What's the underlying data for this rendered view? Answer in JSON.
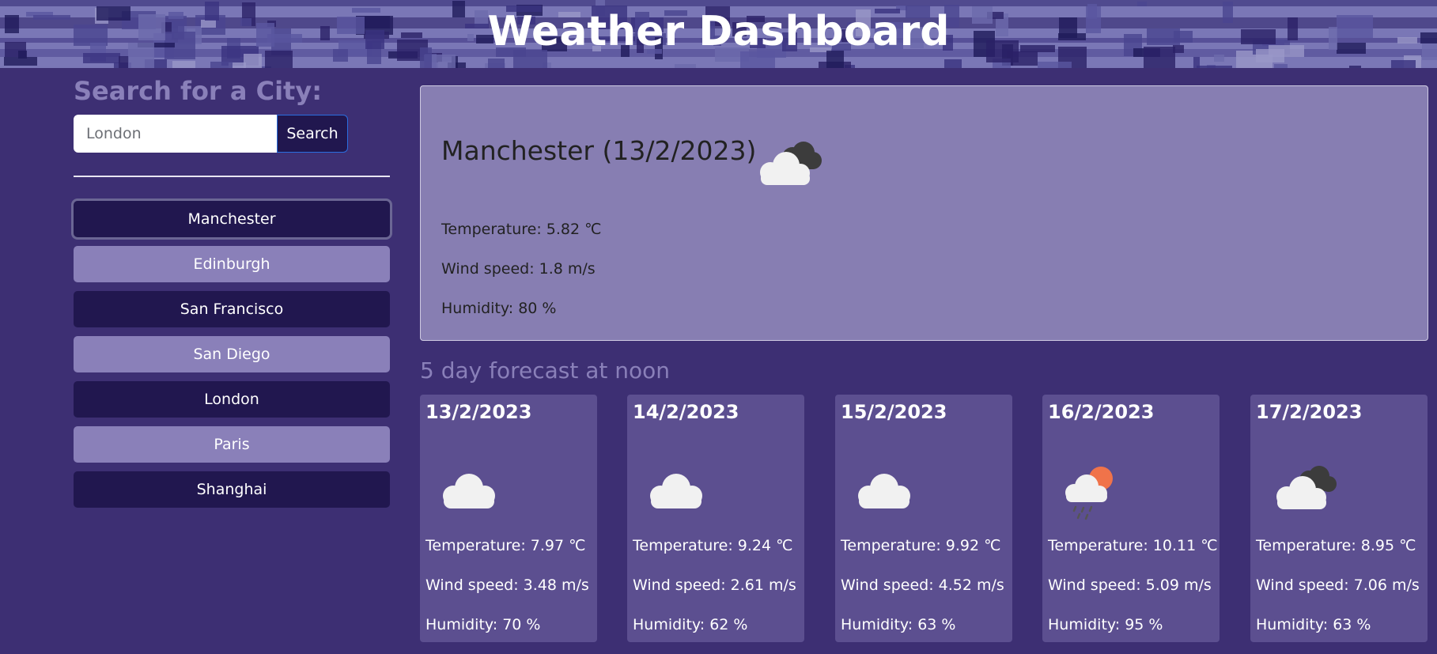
{
  "header": {
    "title": "Weather Dashboard"
  },
  "search": {
    "title": "Search for a City:",
    "placeholder": "London",
    "button_label": "Search"
  },
  "cities": [
    {
      "label": "Manchester",
      "style": "dark",
      "active": true
    },
    {
      "label": "Edinburgh",
      "style": "light"
    },
    {
      "label": "San Francisco",
      "style": "dark"
    },
    {
      "label": "San Diego",
      "style": "light"
    },
    {
      "label": "London",
      "style": "dark"
    },
    {
      "label": "Paris",
      "style": "light"
    },
    {
      "label": "Shanghai",
      "style": "dark"
    }
  ],
  "current": {
    "title": "Manchester (13/2/2023)",
    "icon": "cloudy-icon",
    "temperature": "Temperature: 5.82 ℃",
    "wind": "Wind speed: 1.8 m/s",
    "humidity": "Humidity: 80 %"
  },
  "forecast": {
    "title": "5 day forecast at noon",
    "days": [
      {
        "date": "13/2/2023",
        "icon": "cloud-icon",
        "temperature": "Temperature: 7.97 ℃",
        "wind": "Wind speed: 3.48 m/s",
        "humidity": "Humidity: 70 %"
      },
      {
        "date": "14/2/2023",
        "icon": "cloud-icon",
        "temperature": "Temperature: 9.24 ℃",
        "wind": "Wind speed: 2.61 m/s",
        "humidity": "Humidity: 62 %"
      },
      {
        "date": "15/2/2023",
        "icon": "cloud-icon",
        "temperature": "Temperature: 9.92 ℃",
        "wind": "Wind speed: 4.52 m/s",
        "humidity": "Humidity: 63 %"
      },
      {
        "date": "16/2/2023",
        "icon": "rain-sun-icon",
        "temperature": "Temperature: 10.11 ℃",
        "wind": "Wind speed: 5.09 m/s",
        "humidity": "Humidity: 95 %"
      },
      {
        "date": "17/2/2023",
        "icon": "cloudy-icon",
        "temperature": "Temperature: 8.95 ℃",
        "wind": "Wind speed: 7.06 m/s",
        "humidity": "Humidity: 63 %"
      }
    ]
  },
  "colors": {
    "background": "#3d2f73",
    "dark_button": "#21174f",
    "light_button": "#8a80b9",
    "card": "#5c4f90",
    "current_card": "#877eb2"
  }
}
